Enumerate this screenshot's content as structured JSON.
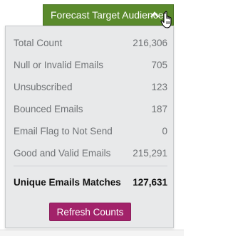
{
  "header": {
    "button_label": "Forecast Target Audience",
    "button_color": "#5a8a2c",
    "chevron_icon": "chevron-up-icon"
  },
  "panel": {
    "background": "#e8e9ea",
    "rows": [
      {
        "label": "Total Count",
        "value": "216,306"
      },
      {
        "label": "Null or Invalid Emails",
        "value": "705"
      },
      {
        "label": "Unsubscribed",
        "value": "123"
      },
      {
        "label": "Bounced Emails",
        "value": "187"
      },
      {
        "label": "Email Flag to Not Send",
        "value": "0"
      },
      {
        "label": "Good and Valid Emails",
        "value": "215,291"
      }
    ],
    "total": {
      "label": "Unique Emails Matches",
      "value": "127,631"
    },
    "refresh_label": "Refresh Counts",
    "refresh_color": "#a2226a"
  }
}
